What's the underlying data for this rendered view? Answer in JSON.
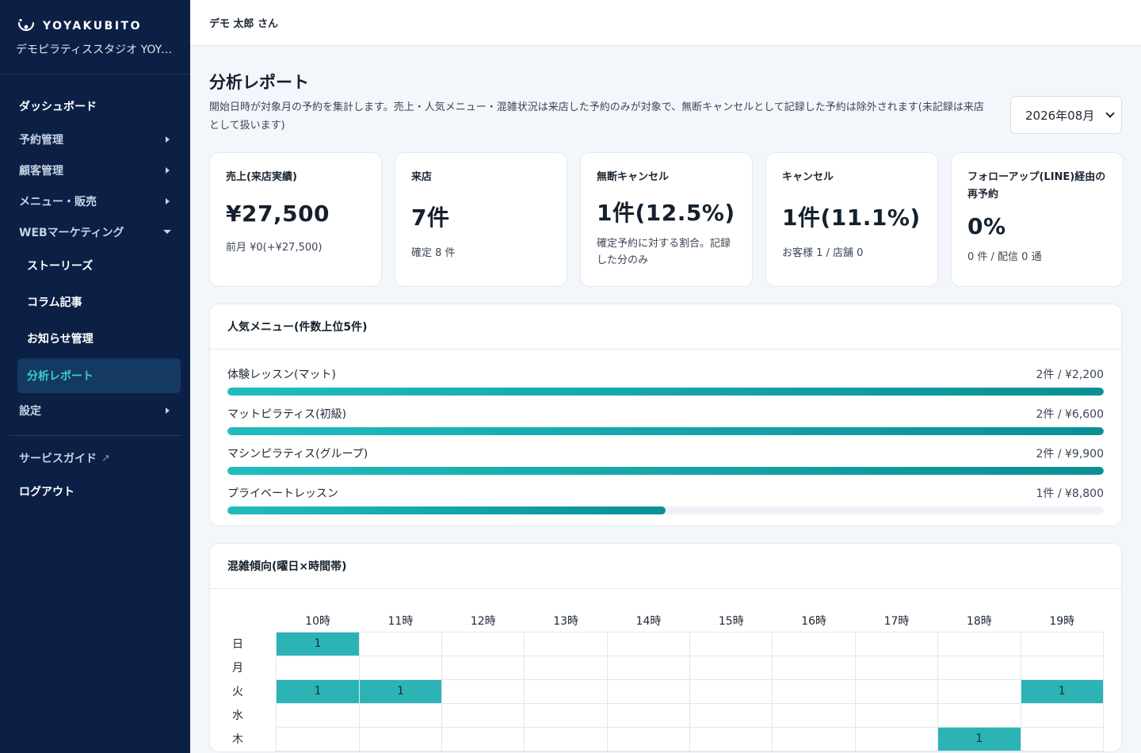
{
  "brand": {
    "name": "YOYAKUBITO",
    "studio": "デモピラティススタジオ YOYAKUBITO"
  },
  "sidebar": {
    "dashboard": "ダッシュボード",
    "reservations": "予約管理",
    "customers": "顧客管理",
    "menu_sales": "メニュー・販売",
    "web_marketing": "WEBマーケティング",
    "sub_items": [
      "ストーリーズ",
      "コラム記事",
      "お知らせ管理",
      "分析レポート"
    ],
    "settings": "設定",
    "service_guide": "サービスガイド",
    "logout": "ログアウト"
  },
  "topbar": {
    "user": "デモ 太郎 さん"
  },
  "page": {
    "title": "分析レポート",
    "description": "開始日時が対象月の予約を集計します。売上・人気メニュー・混雑状況は来店した予約のみが対象で、無断キャンセルとして記録した予約は除外されます(未記録は来店として扱います)",
    "month": "2026年08月"
  },
  "stats": [
    {
      "label": "売上(来店実績)",
      "value": "¥27,500",
      "sub": "前月 ¥0(+¥27,500)"
    },
    {
      "label": "来店",
      "value": "7件",
      "sub": "確定 8 件"
    },
    {
      "label": "無断キャンセル",
      "value": "1件(12.5%)",
      "sub": "確定予約に対する割合。記録した分のみ"
    },
    {
      "label": "キャンセル",
      "value": "1件(11.1%)",
      "sub": "お客様 1 / 店舗 0"
    },
    {
      "label": "フォローアップ(LINE)経由の再予約",
      "value": "0%",
      "sub": "0 件 / 配信 0 通"
    }
  ],
  "popular": {
    "title": "人気メニュー(件数上位5件)",
    "items": [
      {
        "name": "体験レッスン(マット)",
        "summary": "2件 / ¥2,200",
        "ratio": 1.0
      },
      {
        "name": "マットピラティス(初級)",
        "summary": "2件 / ¥6,600",
        "ratio": 1.0
      },
      {
        "name": "マシンピラティス(グループ)",
        "summary": "2件 / ¥9,900",
        "ratio": 1.0
      },
      {
        "name": "プライベートレッスン",
        "summary": "1件 / ¥8,800",
        "ratio": 0.5
      }
    ]
  },
  "heatmap": {
    "title": "混雑傾向(曜日×時間帯)",
    "hours": [
      "10時",
      "11時",
      "12時",
      "13時",
      "14時",
      "15時",
      "16時",
      "17時",
      "18時",
      "19時"
    ],
    "rows": [
      {
        "day": "日",
        "counts": [
          1,
          0,
          0,
          0,
          0,
          0,
          0,
          0,
          0,
          0
        ]
      },
      {
        "day": "月",
        "counts": [
          0,
          0,
          0,
          0,
          0,
          0,
          0,
          0,
          0,
          0
        ]
      },
      {
        "day": "火",
        "counts": [
          1,
          1,
          0,
          0,
          0,
          0,
          0,
          0,
          0,
          1
        ]
      },
      {
        "day": "水",
        "counts": [
          0,
          0,
          0,
          0,
          0,
          0,
          0,
          0,
          0,
          0
        ]
      },
      {
        "day": "木",
        "counts": [
          0,
          0,
          0,
          0,
          0,
          0,
          0,
          0,
          1,
          0
        ]
      }
    ]
  },
  "colors": {
    "sidebar_bg": "#0c1f45",
    "accent": "#2bb3b6",
    "active_text": "#35d2cb"
  }
}
